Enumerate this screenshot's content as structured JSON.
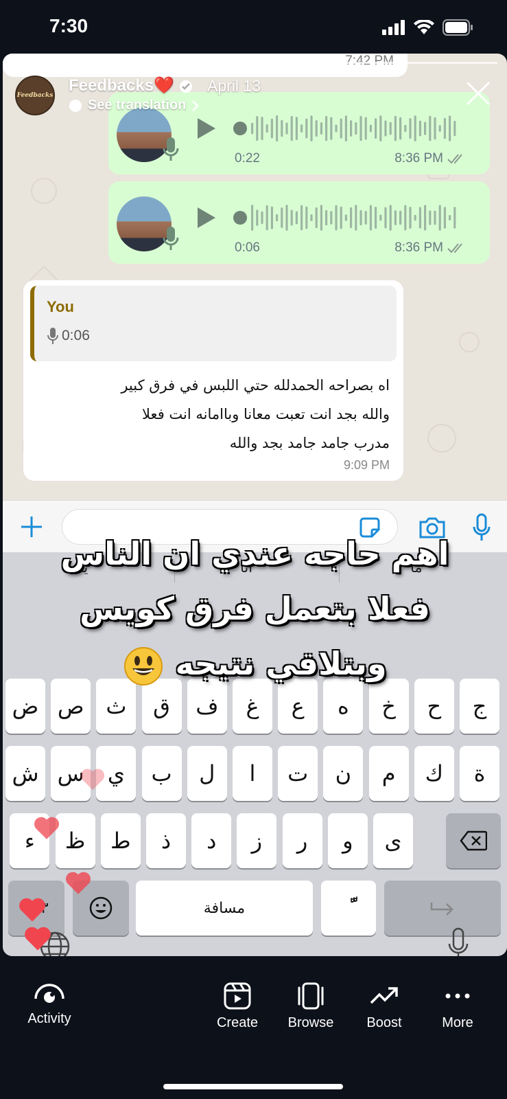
{
  "status_bar": {
    "time": "7:30"
  },
  "story": {
    "username": "Feedbacks",
    "username_emoji": "❤️",
    "date": "April 13",
    "see_translation": "See translation",
    "avatar_text": "Feedbacks"
  },
  "chat": {
    "previous_time": "7:42 PM",
    "voice_messages": [
      {
        "duration": "0:22",
        "time": "8:36 PM"
      },
      {
        "duration": "0:06",
        "time": "8:36 PM"
      }
    ],
    "reply": {
      "quote_name": "You",
      "quote_duration": "0:06",
      "text_lines": [
        "اه بصراحه الحمدلله حتي اللبس في فرق كبير",
        "والله بجد انت تعبت معانا وباامانه انت فعلا",
        "مدرب جامد  جامد بجد والله"
      ],
      "time": "9:09 PM"
    }
  },
  "caption": {
    "lines": [
      "اهم حاجه عندي ان الناس",
      "فعلا بتعمل فرق كويس",
      "وبتلاقي نتيجه"
    ],
    "emoji": "smiley-face"
  },
  "keyboard": {
    "suggestions": [
      "ما",
      "أنا",
      "يا"
    ],
    "row1": [
      "ج",
      "ح",
      "خ",
      "ه",
      "ع",
      "غ",
      "ف",
      "ق",
      "ث",
      "ص",
      "ض"
    ],
    "row2": [
      "ة",
      "ك",
      "م",
      "ن",
      "ت",
      "ا",
      "ل",
      "ب",
      "ي",
      "س",
      "ش"
    ],
    "row3": [
      "ى",
      "و",
      "ر",
      "ز",
      "د",
      "ذ",
      "ط",
      "ظ",
      "ء"
    ],
    "numbers_key": "١٢٣",
    "space_label": "مسافة",
    "diacritic_key": "ًّ"
  },
  "nav": {
    "items": [
      {
        "label": "Activity",
        "icon": "activity-eye-icon"
      },
      {
        "label": "Create",
        "icon": "create-reel-icon"
      },
      {
        "label": "Browse",
        "icon": "browse-icon"
      },
      {
        "label": "Boost",
        "icon": "boost-trend-icon"
      },
      {
        "label": "More",
        "icon": "more-dots-icon"
      }
    ]
  },
  "colors": {
    "outgoing_bubble": "#d9fdd3",
    "chat_background": "#e9e4dc",
    "quote_accent": "#8e6b05",
    "whatsapp_blue": "#1a8cd8",
    "heart": "#f0454f"
  }
}
